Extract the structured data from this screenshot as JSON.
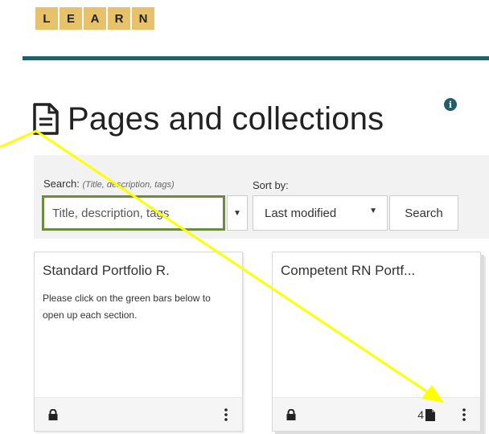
{
  "logo": {
    "letters": [
      "L",
      "E",
      "A",
      "R",
      "N"
    ],
    "color": "#e8c16b"
  },
  "header": {
    "rule_color": "#1f5e6a"
  },
  "page_title": {
    "text": "Pages and collections",
    "icon": "file-text-icon"
  },
  "info": {
    "icon": "info-icon",
    "glyph": "i"
  },
  "search": {
    "label": "Search:",
    "hint": "(Title, description, tags)",
    "placeholder": "Title, description, tags",
    "focus_border_color": "#6a8c3e"
  },
  "sort": {
    "label": "Sort by:",
    "selected": "Last modified"
  },
  "search_button": {
    "label": "Search"
  },
  "cards": [
    {
      "title": "Standard Portfolio R.",
      "description": "Please click on the green bars below to open up each section.",
      "footer": {
        "lock": "lock-icon",
        "menu": "more-vertical-icon"
      }
    },
    {
      "title": "Competent RN Portf...",
      "description": "",
      "footer": {
        "lock": "lock-icon",
        "page_count": "4",
        "page_icon": "file-icon",
        "menu": "more-vertical-icon"
      }
    }
  ],
  "annotation": {
    "type": "arrow",
    "color": "#ffff00"
  }
}
